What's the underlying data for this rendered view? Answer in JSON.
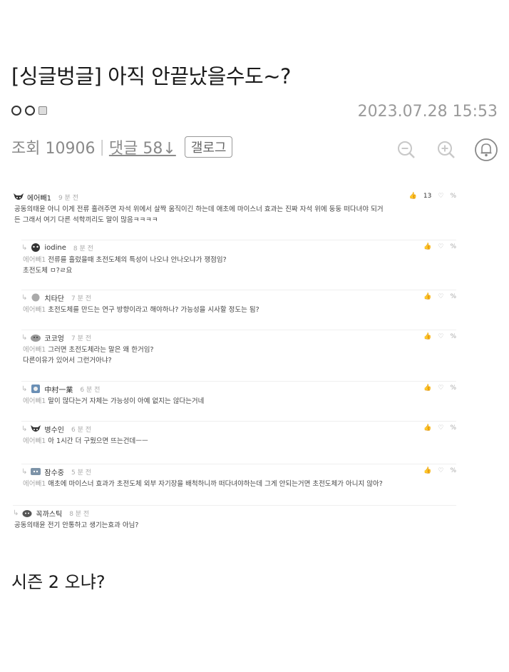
{
  "post": {
    "title": "[싱글벙글] 아직 안끝났을수도~?",
    "date": "2023.07.28 15:53",
    "views_label": "조회 10906",
    "comments_label": "댓글 58↓",
    "gallog_label": "갤로그"
  },
  "comments": [
    {
      "name": "에어빼1",
      "time": "9 분 전",
      "likes": "13",
      "lines": [
        {
          "mention": "",
          "text": "공동의태윤 아니 이게 전류 흘려주면 자석 위에서 살짝 움직이긴 하는데 애초에 마이스너 효과는 진짜 자석 위에 둥둥 떠다녀야 되거"
        },
        {
          "mention": "",
          "text": "든 그래서 여기 다른 석학끼리도 말이 많음ㅋㅋㅋㅋ"
        }
      ]
    },
    {
      "name": "iodine",
      "time": "8 분 전",
      "lines": [
        {
          "mention": "에어빼1",
          "text": "전류를 흘렀을때 초전도체의 특성이 나오냐 안나오냐가 쟁점임?"
        },
        {
          "mention": "",
          "text": "초전도체 ㅁ?ㄹ요"
        }
      ]
    },
    {
      "name": "치타단",
      "time": "7 분 전",
      "lines": [
        {
          "mention": "에어빼1",
          "text": "초전도체를 만드는 연구 방향이라고 해야하나? 가능성을 시사할 정도는 됨?"
        }
      ]
    },
    {
      "name": "코코엉",
      "time": "7 분 전",
      "lines": [
        {
          "mention": "에어빼1",
          "text": "그러면 초전도체라는 말은 왜 한거임?"
        },
        {
          "mention": "",
          "text": "다른이유가 있어서 그런거아냐?"
        }
      ]
    },
    {
      "name": "中村一業",
      "time": "6 분 전",
      "lines": [
        {
          "mention": "에어빼1",
          "text": "말이 많다는거 자체는 가능성이 아예 없지는 않다는거네"
        }
      ]
    },
    {
      "name": "병수인",
      "time": "6 분 전",
      "lines": [
        {
          "mention": "에어빼1",
          "text": "아 1시간 더 구웠으면 뜨는건데ㅡㅡ"
        }
      ]
    },
    {
      "name": "잠수중",
      "time": "5 분 전",
      "lines": [
        {
          "mention": "에어빼1",
          "text": "애초에 마이스너 효과가 초전도체 외부 자기장을 배척하니까 떠다녀야하는데 그게 안되는거면 초전도체가 아니지 않아?"
        }
      ]
    },
    {
      "name": "꼭까스틱",
      "time": "8 분 전",
      "lines": [
        {
          "mention": "",
          "text": "공동의태윤 전기 안통하고 생기는효과 아님?"
        }
      ]
    }
  ],
  "footer": {
    "text": "시즌 2 오냐?"
  },
  "icons": {
    "like": "thumbs-up-icon",
    "dislike": "thumbs-down-icon",
    "share": "share-icon",
    "zoom_out": "zoom-out-icon",
    "zoom_in": "zoom-in-icon",
    "alarm": "bell-icon"
  }
}
